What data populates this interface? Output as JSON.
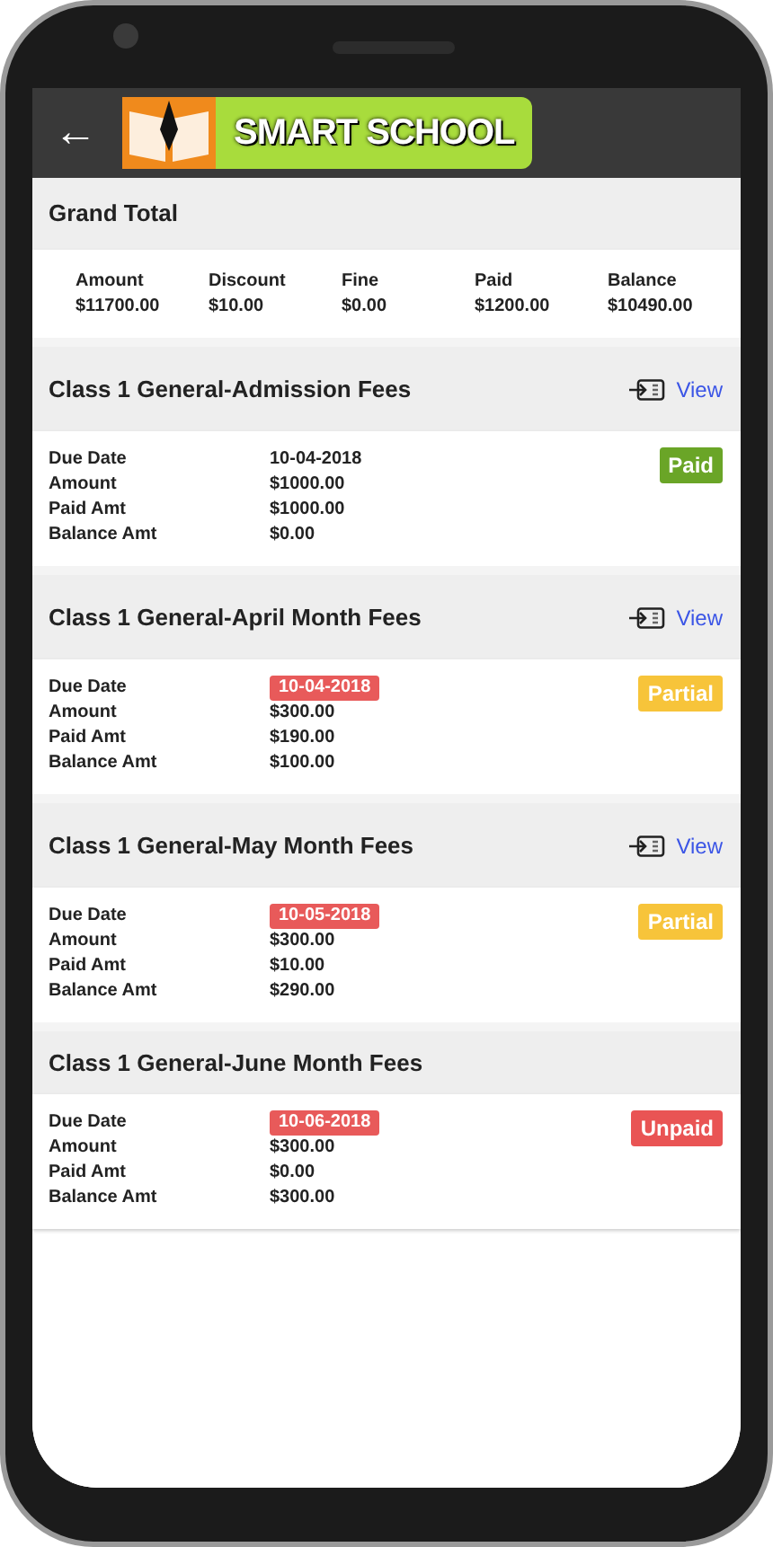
{
  "app_bar": {
    "back": "←",
    "logo_text": "SMART SCHOOL"
  },
  "grand_total": {
    "title": "Grand Total",
    "columns": [
      {
        "label": "Amount",
        "value": "$11700.00"
      },
      {
        "label": "Discount",
        "value": "$10.00"
      },
      {
        "label": "Fine",
        "value": "$0.00"
      },
      {
        "label": "Paid",
        "value": "$1200.00"
      },
      {
        "label": "Balance",
        "value": "$10490.00"
      }
    ]
  },
  "fees": [
    {
      "title": "Class 1 General-Admission Fees",
      "view": "View",
      "status": {
        "kind": "paid",
        "label": "Paid"
      },
      "rows": [
        {
          "label": "Due Date",
          "value": "10-04-2018",
          "highlighted": false
        },
        {
          "label": "Amount",
          "value": "$1000.00",
          "highlighted": false
        },
        {
          "label": "Paid Amt",
          "value": "$1000.00",
          "highlighted": false
        },
        {
          "label": "Balance Amt",
          "value": "$0.00",
          "highlighted": false
        }
      ]
    },
    {
      "title": "Class 1 General-April Month Fees",
      "view": "View",
      "status": {
        "kind": "partial",
        "label": "Partial"
      },
      "rows": [
        {
          "label": "Due Date",
          "value": "10-04-2018",
          "highlighted": true
        },
        {
          "label": "Amount",
          "value": "$300.00",
          "highlighted": false
        },
        {
          "label": "Paid Amt",
          "value": "$190.00",
          "highlighted": false
        },
        {
          "label": "Balance Amt",
          "value": "$100.00",
          "highlighted": false
        }
      ]
    },
    {
      "title": "Class 1 General-May Month Fees",
      "view": "View",
      "status": {
        "kind": "partial",
        "label": "Partial"
      },
      "rows": [
        {
          "label": "Due Date",
          "value": "10-05-2018",
          "highlighted": true
        },
        {
          "label": "Amount",
          "value": "$300.00",
          "highlighted": false
        },
        {
          "label": "Paid Amt",
          "value": "$10.00",
          "highlighted": false
        },
        {
          "label": "Balance Amt",
          "value": "$290.00",
          "highlighted": false
        }
      ]
    },
    {
      "title": "Class 1 General-June Month Fees",
      "status": {
        "kind": "unpaid",
        "label": "Unpaid"
      },
      "rows": [
        {
          "label": "Due Date",
          "value": "10-06-2018",
          "highlighted": true
        },
        {
          "label": "Amount",
          "value": "$300.00",
          "highlighted": false
        },
        {
          "label": "Paid Amt",
          "value": "$0.00",
          "highlighted": false
        },
        {
          "label": "Balance Amt",
          "value": "$300.00",
          "highlighted": false
        }
      ]
    }
  ]
}
